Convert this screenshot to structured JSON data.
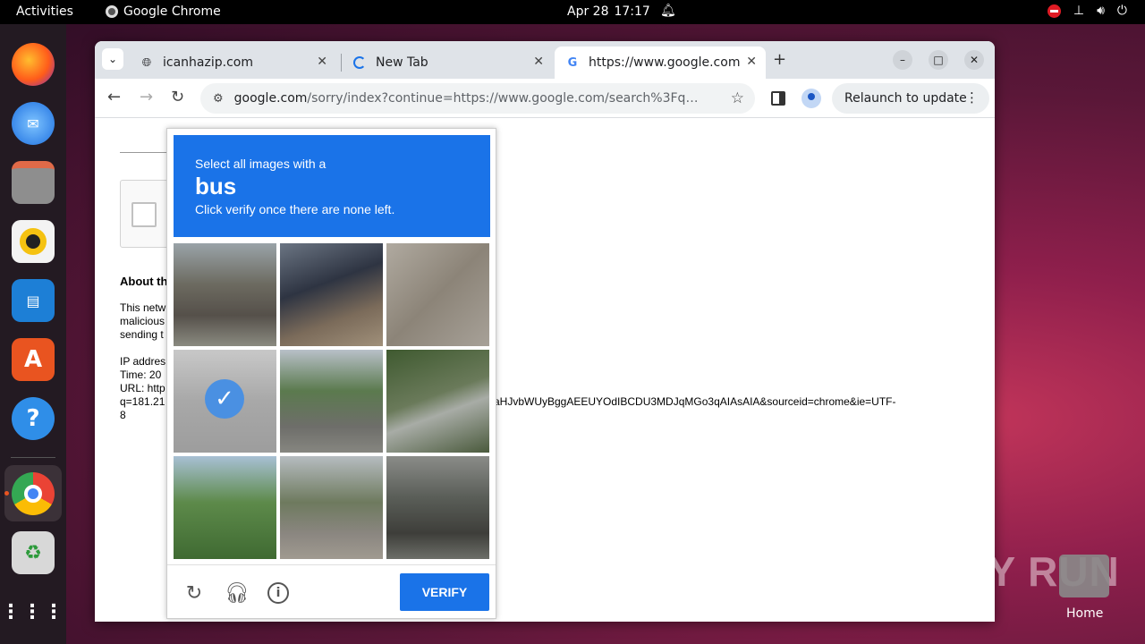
{
  "topbar": {
    "activities": "Activities",
    "app_name": "Google Chrome",
    "date": "Apr 28",
    "time": "17:17"
  },
  "dock": {
    "items": [
      "firefox",
      "thunderbird",
      "files",
      "rhythmbox",
      "libreoffice-writer",
      "app-center",
      "help",
      "chrome",
      "trash",
      "show-apps"
    ]
  },
  "browser": {
    "tabs": [
      {
        "title": "icanhazip.com",
        "icon": "globe-icon"
      },
      {
        "title": "New Tab",
        "icon": "loading-icon"
      },
      {
        "title": "https://www.google.com",
        "icon": "google-icon",
        "active": true
      }
    ],
    "url_host": "google.com",
    "url_path": "/sorry/index?continue=https://www.google.com/search%3Fq%3D181.2...",
    "relaunch_label": "Relaunch to update"
  },
  "page": {
    "about_heading": "About th",
    "para1": [
      "This netw",
      "malicious",
      "sending t"
    ],
    "info_lines": [
      "IP addres",
      "Time: 20",
      "URL: http",
      "q=181.21",
      "8"
    ],
    "url_tail": "aHJvbWUyBggAEEUYOdIBCDU3MDJqMGo3qAIAsAIA&sourceid=chrome&ie=UTF-"
  },
  "captcha": {
    "line1": "Select all images with a",
    "target": "bus",
    "line3": "Click verify once there are none left.",
    "verify_label": "VERIFY",
    "tiles": [
      {
        "scene": "street-traffic-light",
        "selected": false
      },
      {
        "scene": "house-roof",
        "selected": false
      },
      {
        "scene": "motorcycle-sidewalk",
        "selected": false
      },
      {
        "scene": "street-buildings",
        "selected": true
      },
      {
        "scene": "road-trees",
        "selected": false
      },
      {
        "scene": "guardrail",
        "selected": false
      },
      {
        "scene": "tree-sky",
        "selected": false
      },
      {
        "scene": "intersection",
        "selected": false
      },
      {
        "scene": "overpass-bridge",
        "selected": false
      }
    ]
  },
  "desktop": {
    "watermark": "ANY RUN",
    "home_label": "Home"
  }
}
